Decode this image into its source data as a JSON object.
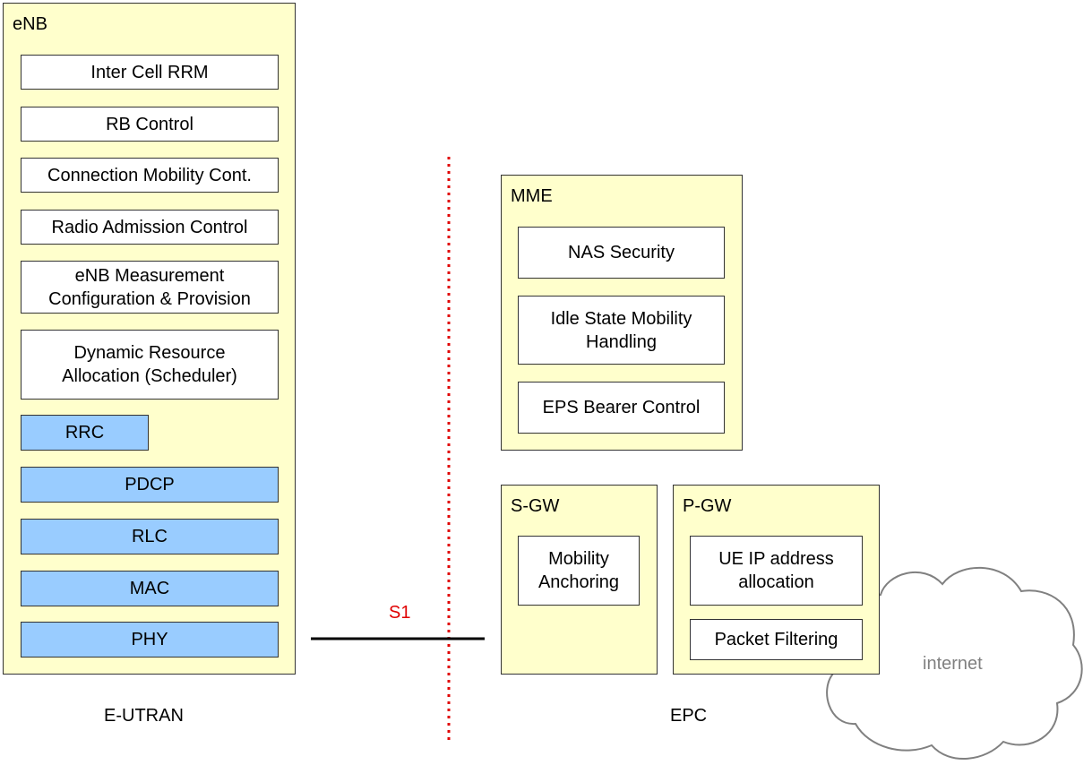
{
  "enb": {
    "title": "eNB",
    "functions": [
      "Inter Cell RRM",
      "RB Control",
      "Connection Mobility Cont.",
      "Radio Admission Control",
      "eNB Measurement Configuration & Provision",
      "Dynamic Resource Allocation (Scheduler)"
    ],
    "protocol_stack": [
      "RRC",
      "PDCP",
      "RLC",
      "MAC",
      "PHY"
    ]
  },
  "mme": {
    "title": "MME",
    "functions": [
      "NAS Security",
      "Idle State Mobility Handling",
      "EPS Bearer Control"
    ]
  },
  "sgw": {
    "title": "S-GW",
    "functions": [
      "Mobility Anchoring"
    ]
  },
  "pgw": {
    "title": "P-GW",
    "functions": [
      "UE IP address allocation",
      "Packet Filtering"
    ]
  },
  "interface_label": "S1",
  "cloud_label": "internet",
  "region_labels": {
    "eutran": "E-UTRAN",
    "epc": "EPC"
  },
  "colors": {
    "node_fill": "#ffffcc",
    "protocol_fill": "#99ccff",
    "boundary": "#e00000",
    "cloud_stroke": "#808080"
  }
}
